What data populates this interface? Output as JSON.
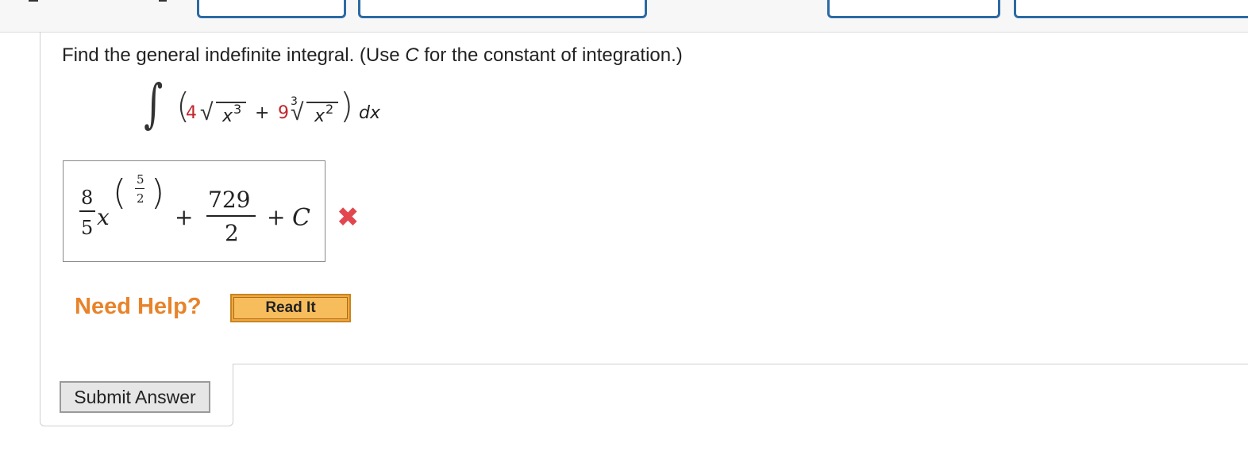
{
  "question": {
    "text_before": "Find the general indefinite integral. (Use ",
    "var": "C",
    "text_after": " for the constant of integration.)"
  },
  "integral": {
    "coef1": "4",
    "base1": "x",
    "exp1": "3",
    "plus": "+",
    "coef2": "9",
    "root_index": "3",
    "base2": "x",
    "exp2": "2",
    "dx": "dx"
  },
  "answer": {
    "frac1_num": "8",
    "frac1_den": "5",
    "var": "x",
    "exp_num": "5",
    "exp_den": "2",
    "plus1": "+",
    "frac2_num": "729",
    "frac2_den": "2",
    "plus2": "+",
    "const": "C",
    "status_icon": "✖"
  },
  "help": {
    "label": "Need Help?",
    "read_it": "Read It"
  },
  "submit": {
    "label": "Submit Answer"
  },
  "colors": {
    "accent_blue": "#2c6aa3",
    "red_coef": "#c0272d",
    "wrong": "#e2474f",
    "help_orange": "#e8832a",
    "button_orange": "#f2a840"
  }
}
